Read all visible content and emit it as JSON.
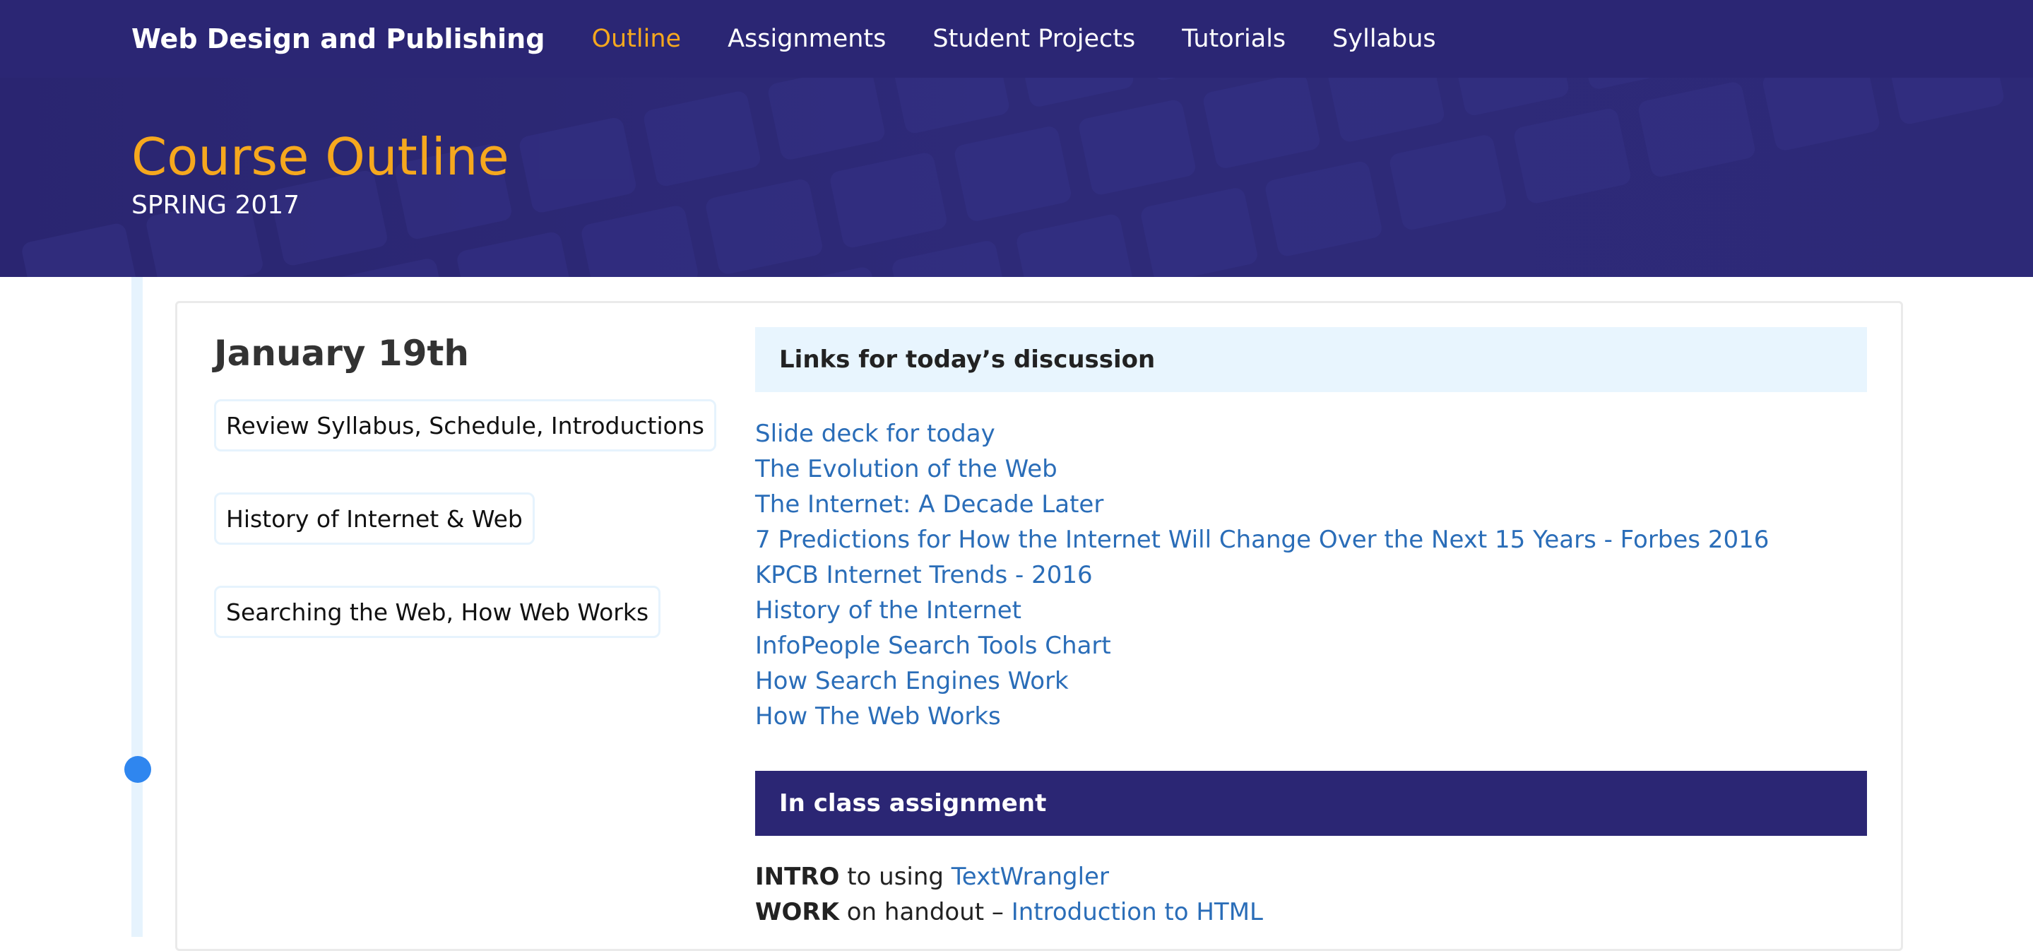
{
  "navbar": {
    "brand": "Web Design and Publishing",
    "links": [
      {
        "label": "Outline",
        "active": true
      },
      {
        "label": "Assignments",
        "active": false
      },
      {
        "label": "Student Projects",
        "active": false
      },
      {
        "label": "Tutorials",
        "active": false
      },
      {
        "label": "Syllabus",
        "active": false
      }
    ]
  },
  "hero": {
    "title": "Course Outline",
    "subtitle": "SPRING 2017"
  },
  "entry": {
    "date": "January 19th",
    "topics": [
      "Review Syllabus, Schedule, Introductions",
      "History of Internet & Web",
      "Searching the Web, How Web Works"
    ],
    "links_header": "Links for today’s discussion",
    "links": [
      "Slide deck for today",
      "The Evolution of the Web",
      "The Internet: A Decade Later",
      "7 Predictions for How the Internet Will Change Over the Next 15 Years - Forbes 2016",
      "KPCB Internet Trends - 2016",
      "History of the Internet",
      "InfoPeople Search Tools Chart",
      "How Search Engines Work",
      "How The Web Works"
    ],
    "assignment_header": "In class assignment",
    "assignments": [
      {
        "verb": "INTRO",
        "text": " to using ",
        "link": "TextWrangler"
      },
      {
        "verb": "WORK",
        "text": " on handout – ",
        "link": "Introduction to HTML"
      }
    ]
  },
  "colors": {
    "navbar_bg": "#2b2674",
    "accent_orange": "#f6a81e",
    "link_blue": "#2a6db8",
    "timeline_dot": "#2f86ef",
    "light_blue": "#e8f5fe"
  }
}
